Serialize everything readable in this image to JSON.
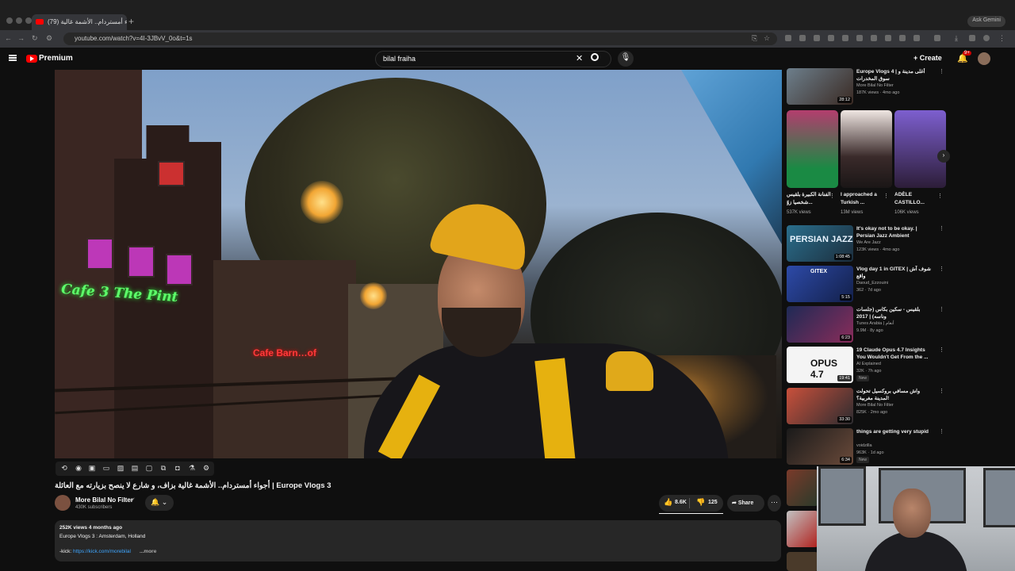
{
  "browser": {
    "tab_title": "(79) أجواء أمستردام.. الأشمة غالية...",
    "new_tab": "+",
    "url": "youtube.com/watch?v=4I-3JBvV_0o&t=1s",
    "gemini_button": "Ask Gemini"
  },
  "youtube": {
    "logo_text": "Premium",
    "search_value": "bilal fraiha",
    "create_label": "Create",
    "notif_count": "9+"
  },
  "video": {
    "neon_sign": "Cafe 3  The Pint",
    "neon_sign2": "Cafe Barn…of",
    "title": "أجواء أمستردام.. الأشمة غالية بزاف، و شارع لا ينصح بزيارته مع العائلة | Europe Vlogs 3",
    "channel_name": "More Bilal No Filter",
    "verified_mark": "✓",
    "subscribers": "430K subscribers",
    "likes": "8.6K",
    "dislikes": "125",
    "share_label": "Share",
    "description": {
      "meta": "252K views  4 months ago",
      "line1": "Europe Vlogs 3 : Amsterdam, Holland",
      "link_prefix": "-kick: ",
      "link": "https://kick.com/morebilal",
      "more": "...more"
    }
  },
  "sidebar": {
    "top_item": {
      "title": "Europe Vlogs 4 | أغلى مدينة و سوق المخدرات",
      "channel": "More Bilal No Filter",
      "views": "187K views · 4mo ago",
      "duration": "28:12"
    },
    "shorts": [
      {
        "title": "الفنانة الكبيرة بلقيس شخصيا زوّ...",
        "views": "537K views"
      },
      {
        "title": "I approached a Turkish ...",
        "views": "13M views"
      },
      {
        "title": "ADÈLE CASTILLO...",
        "views": "106K views"
      }
    ],
    "items": [
      {
        "title": "It's okay not to be okay. | Persian Jazz Ambient",
        "channel": "We Are Jazz",
        "views": "123K views · 4mo ago",
        "duration": "1:08:45",
        "thumb_text": "PERSIAN JAZZ"
      },
      {
        "title": "Vlog day 1 in GITEX | شوف آش واقع",
        "channel": "Daoud_Ezzouini",
        "views": "362 · 7d ago",
        "duration": "5:15",
        "thumb_text": "GITEX"
      },
      {
        "title": "بلقيس - سكين بكاس (جلسات وناسه) | 2017",
        "channel": "Tunes Arabia | أنغام",
        "views": "9.9M · 8y ago",
        "duration": "6:23",
        "thumb_text": ""
      },
      {
        "title": "19 Claude Opus 4.7 Insights You Wouldn't Get From the ...",
        "channel": "AI Explained",
        "views": "32K · 7h ago",
        "duration": "19:41",
        "thumb_text": "OPUS 4.7",
        "new": "New"
      },
      {
        "title": "واش مسافي بروكسيل تحولت لمدينة مغربية؟!",
        "channel": "More Bilal No Filter",
        "views": "825K · 2mo ago",
        "duration": "33:30",
        "thumb_text": ""
      },
      {
        "title": "things are getting very stupid",
        "channel": "voidzilla",
        "views": "963K · 1d ago",
        "duration": "6:34",
        "thumb_text": "",
        "new": "New"
      }
    ]
  },
  "colors": {
    "yt_red": "#ff0000",
    "link": "#3ea6ff",
    "bg": "#0f0f0f"
  }
}
